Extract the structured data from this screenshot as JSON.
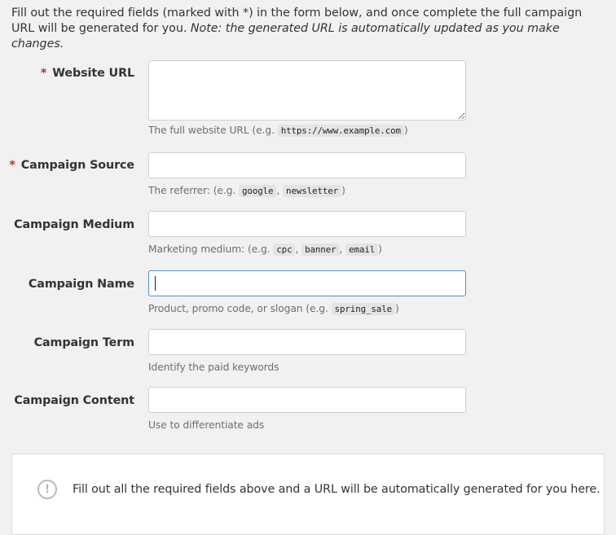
{
  "intro": {
    "text": "Fill out the required fields (marked with *) in the form below, and once complete the full campaign URL will be generated for you.",
    "note": "Note: the generated URL is automatically updated as you make changes."
  },
  "required_marker": "*",
  "fields": [
    {
      "label": "Website URL",
      "required": true,
      "value": "",
      "help_prefix": "The full website URL (e.g. ",
      "examples": [
        "https://www.example.com"
      ],
      "help_suffix": ")"
    },
    {
      "label": "Campaign Source",
      "required": true,
      "value": "",
      "help_prefix": "The referrer: (e.g. ",
      "examples": [
        "google",
        "newsletter"
      ],
      "help_suffix": ")"
    },
    {
      "label": "Campaign Medium",
      "required": false,
      "value": "",
      "help_prefix": "Marketing medium: (e.g. ",
      "examples": [
        "cpc",
        "banner",
        "email"
      ],
      "help_suffix": ")"
    },
    {
      "label": "Campaign Name",
      "required": false,
      "value": "",
      "focused": true,
      "help_prefix": "Product, promo code, or slogan (e.g. ",
      "examples": [
        "spring_sale"
      ],
      "help_suffix": ")"
    },
    {
      "label": "Campaign Term",
      "required": false,
      "value": "",
      "help_prefix": "Identify the paid keywords",
      "examples": [],
      "help_suffix": ""
    },
    {
      "label": "Campaign Content",
      "required": false,
      "value": "",
      "help_prefix": "Use to differentiate ads",
      "examples": [],
      "help_suffix": ""
    }
  ],
  "separator": ", ",
  "result": {
    "icon": "exclamation-circle-icon",
    "icon_glyph": "!",
    "message": "Fill out all the required fields above and a URL will be automatically generated for you here."
  },
  "colors": {
    "required": "#c9252c",
    "focus_border": "#4d90d3",
    "background": "#f1f1f1"
  }
}
